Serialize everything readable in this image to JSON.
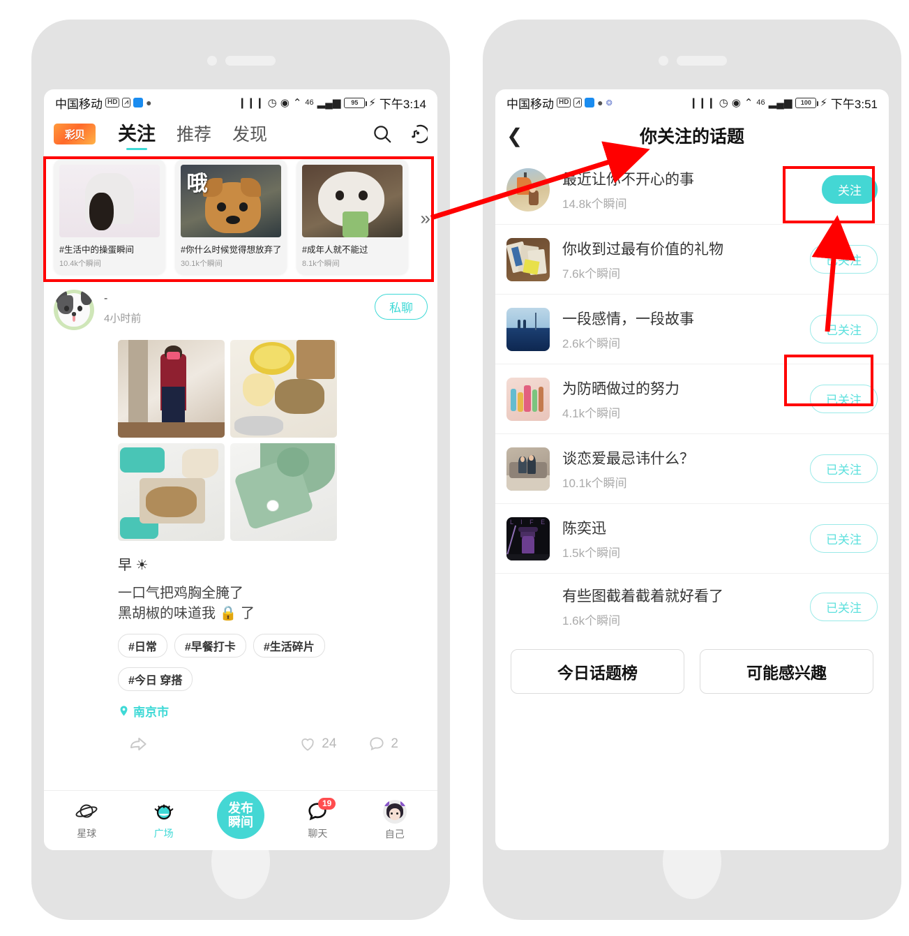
{
  "left_phone": {
    "status_bar": {
      "carrier": "中国移动",
      "hd_badge": "HD",
      "battery": "95",
      "clock": "下午3:14"
    },
    "header": {
      "logo_text": "彩贝",
      "tabs": [
        {
          "label": "关注",
          "active": true
        },
        {
          "label": "推荐",
          "active": false
        },
        {
          "label": "发现",
          "active": false
        }
      ],
      "search_icon": "search-icon",
      "music_icon": "music-note-icon"
    },
    "topic_cards": [
      {
        "title": "#生活中的操蛋瞬间",
        "count": "10.4k个瞬间"
      },
      {
        "title": "#你什么时候觉得想放弃了",
        "count": "30.1k个瞬间"
      },
      {
        "title": "#成年人就不能过",
        "count": "8.1k个瞬间"
      }
    ],
    "cards_more": "»",
    "post": {
      "user_name": "-",
      "time": "4小时前",
      "chat_button": "私聊",
      "line1": "早 ☀",
      "text": "一口气把鸡胸全腌了\n黑胡椒的味道我 🔒 了",
      "tags": [
        "#日常",
        "#早餐打卡",
        "#生活碎片",
        "#今日  穿搭"
      ],
      "location": "南京市",
      "like_count": "24",
      "comment_count": "2"
    },
    "bottom_nav": {
      "items": [
        {
          "label": "星球",
          "icon": "planet-icon",
          "active": false
        },
        {
          "label": "广场",
          "icon": "eye-icon",
          "active": true
        },
        {
          "label": "聊天",
          "icon": "chat-bubble-icon",
          "active": false,
          "badge": "19"
        },
        {
          "label": "自己",
          "icon": "profile-avatar-icon",
          "active": false
        }
      ],
      "fab_line1": "发布",
      "fab_line2": "瞬间"
    }
  },
  "right_phone": {
    "status_bar": {
      "carrier": "中国移动",
      "hd_badge": "HD",
      "battery": "100",
      "clock": "下午3:51"
    },
    "nav": {
      "back_icon": "chevron-left-icon",
      "title": "你关注的话题"
    },
    "topics": [
      {
        "title": "最近让你不开心的事",
        "count": "14.8k个瞬间",
        "button": "关注",
        "followed": false
      },
      {
        "title": "你收到过最有价值的礼物",
        "count": "7.6k个瞬间",
        "button": "已关注",
        "followed": true
      },
      {
        "title": "一段感情，一段故事",
        "count": "2.6k个瞬间",
        "button": "已关注",
        "followed": true
      },
      {
        "title": "为防晒做过的努力",
        "count": "4.1k个瞬间",
        "button": "已关注",
        "followed": true
      },
      {
        "title": "谈恋爱最忌讳什么？",
        "count": "10.1k个瞬间",
        "button": "已关注",
        "followed": true
      },
      {
        "title": "陈奕迅",
        "count": "1.5k个瞬间",
        "button": "已关注",
        "followed": true
      },
      {
        "title": "有些图截着截着就好看了",
        "count": "1.6k个瞬间",
        "button": "已关注",
        "followed": true
      }
    ],
    "footer_buttons": [
      {
        "label": "今日话题榜"
      },
      {
        "label": "可能感兴趣"
      }
    ]
  },
  "annotations": {
    "highlight_color": "#ff0000",
    "boxes": [
      {
        "name": "topic-strip-highlight"
      },
      {
        "name": "follow-button-highlight"
      },
      {
        "name": "followed-button-highlight"
      }
    ],
    "arrows": [
      {
        "name": "arrow-to-title"
      },
      {
        "name": "arrow-to-follow-button"
      }
    ]
  },
  "theme": {
    "accent": "#44d7d4",
    "accent_light": "#9aeae8",
    "red": "#ff0000",
    "badge_red": "#ff4d4f"
  }
}
